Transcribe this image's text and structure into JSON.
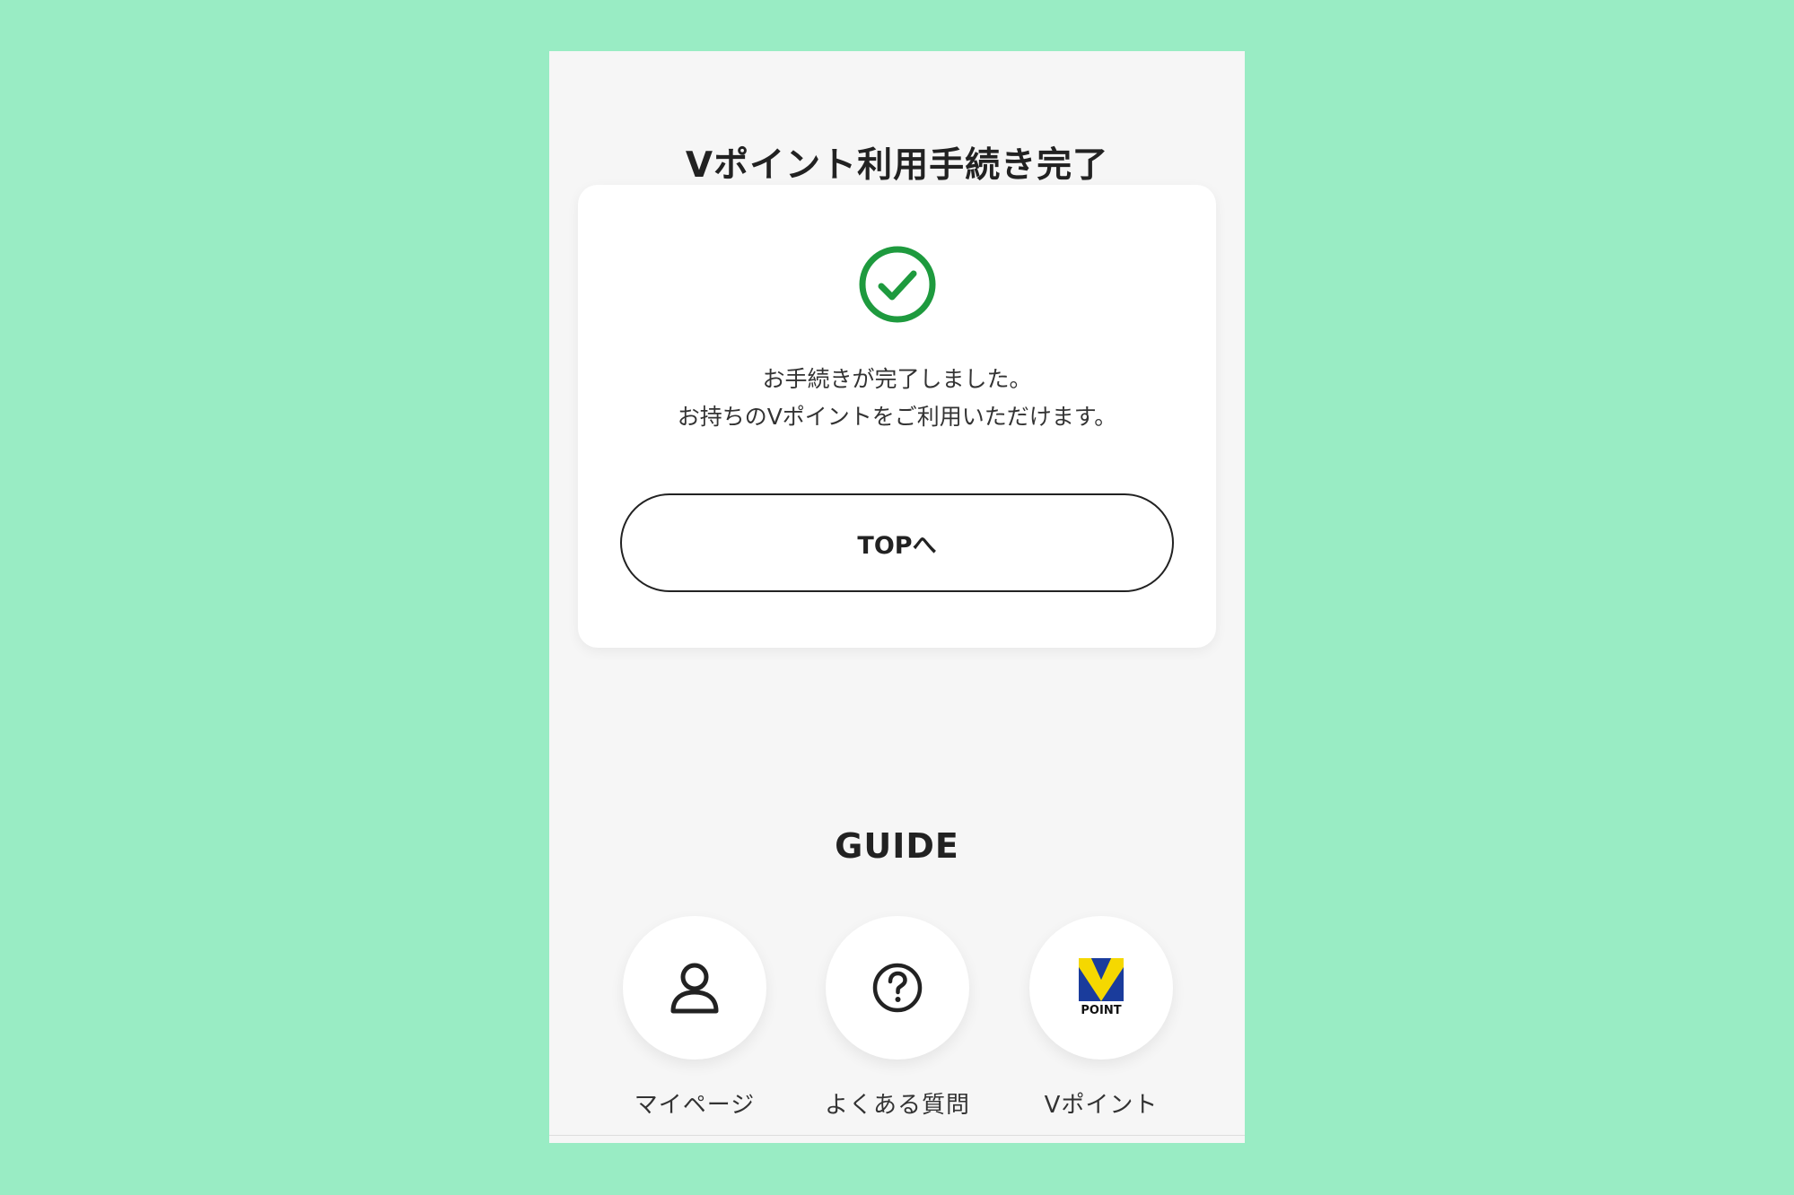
{
  "page": {
    "title": "Vポイント利用手続き完了",
    "background_color": "#99ecc4",
    "panel_color": "#f6f6f6",
    "accent_color": "#1e9a3e"
  },
  "card": {
    "icon": "check-circle-icon",
    "message_line1": "お手続きが完了しました。",
    "message_line2": "お持ちのVポイントをご利用いただけます。",
    "button_label": "TOPへ"
  },
  "guide": {
    "title": "GUIDE",
    "items": [
      {
        "label": "マイページ",
        "icon": "user-icon"
      },
      {
        "label": "よくある質問",
        "icon": "question-circle-icon"
      },
      {
        "label": "Vポイント",
        "icon": "vpoint-logo-icon",
        "logo_text": "POINT"
      }
    ]
  }
}
